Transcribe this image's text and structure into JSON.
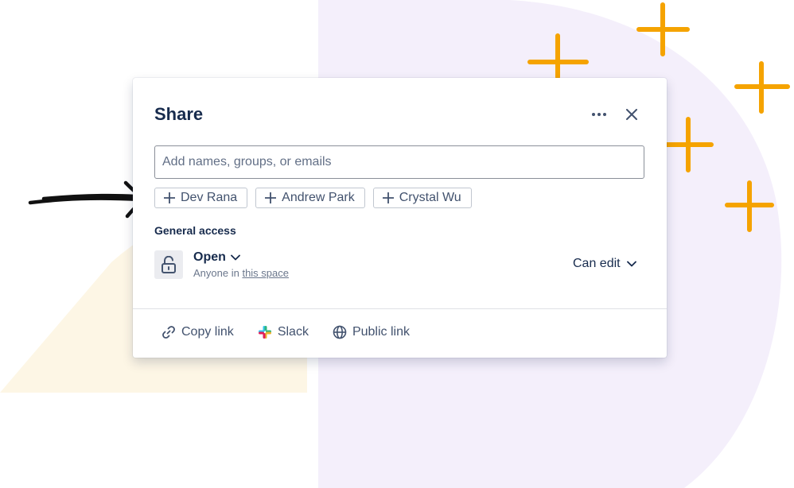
{
  "dialog": {
    "title": "Share",
    "more_icon": "more-horizontal-icon",
    "close_icon": "close-icon"
  },
  "search": {
    "placeholder": "Add names, groups, or emails",
    "value": ""
  },
  "suggestions": [
    {
      "label": "Dev Rana",
      "icon": "plus-icon"
    },
    {
      "label": "Andrew Park",
      "icon": "plus-icon"
    },
    {
      "label": "Crystal Wu",
      "icon": "plus-icon"
    }
  ],
  "general_access": {
    "heading": "General access",
    "icon": "unlock-icon",
    "level": "Open",
    "subtitle_prefix": "Anyone in",
    "subtitle_link": "this space",
    "permission": "Can edit"
  },
  "footer": [
    {
      "label": "Copy link",
      "icon": "link-icon"
    },
    {
      "label": "Slack",
      "icon": "slack-icon"
    },
    {
      "label": "Public link",
      "icon": "globe-icon"
    }
  ],
  "colors": {
    "title": "#172b4d",
    "text_secondary": "#42526e",
    "accent_orange": "#f5a300",
    "bg_purple": "#f4effb",
    "bg_cream": "#fdf6e5"
  }
}
